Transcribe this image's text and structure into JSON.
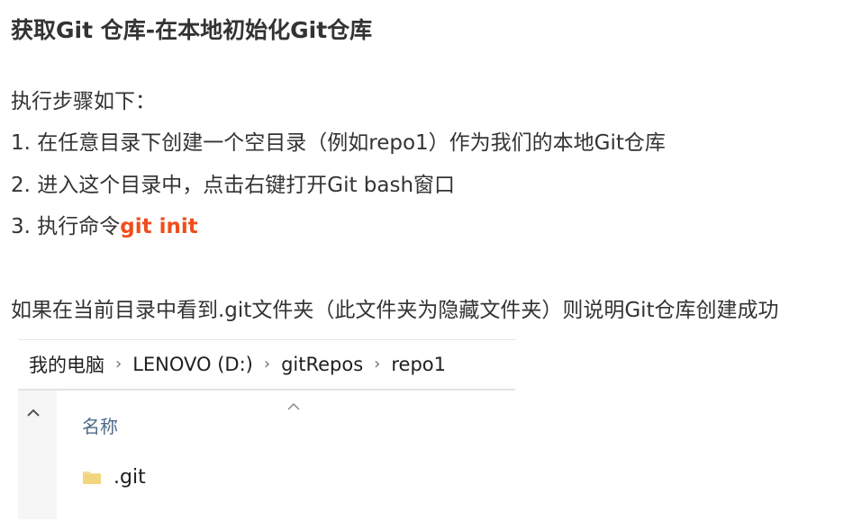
{
  "title": "获取Git 仓库-在本地初始化Git仓库",
  "intro": "执行步骤如下：",
  "steps": [
    {
      "text": "1. 在任意目录下创建一个空目录（例如repo1）作为我们的本地Git仓库"
    },
    {
      "text": "2. 进入这个目录中，点击右键打开Git bash窗口"
    },
    {
      "text": "3. 执行命令",
      "command": "git init"
    }
  ],
  "note": "如果在当前目录中看到.git文件夹（此文件夹为隐藏文件夹）则说明Git仓库创建成功",
  "colors": {
    "command": "#ee4e1d",
    "text": "#333333",
    "explorer_header": "#4d6b8a"
  },
  "explorer": {
    "breadcrumb": [
      "我的电脑",
      "LENOVO (D:)",
      "gitRepos",
      "repo1"
    ],
    "separator_icon": "chevron-right-icon",
    "collapse_icon": "chevron-up-icon",
    "sort_icon": "sort-ascending-icon",
    "column_header": "名称",
    "files": [
      {
        "name": ".git",
        "icon": "folder-icon"
      }
    ]
  }
}
